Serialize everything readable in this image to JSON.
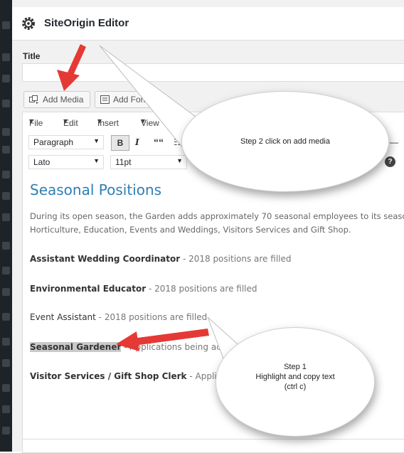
{
  "header": {
    "title": "SiteOrigin Editor"
  },
  "title_field": {
    "label": "Title",
    "value": ""
  },
  "media_buttons": {
    "add_media": "Add Media",
    "add_form": "Add Form"
  },
  "menubar": {
    "file": "File",
    "edit": "Edit",
    "insert": "Insert",
    "view": "View"
  },
  "toolbar": {
    "format": "Paragraph",
    "font": "Lato",
    "size": "11pt",
    "bold": "B",
    "italic": "I",
    "quote": "““",
    "dash": "—",
    "help": "?"
  },
  "content": {
    "heading": "Seasonal Positions",
    "intro_line1": "During its open season, the Garden adds approximately 70 seasonal employees to its seaso",
    "intro_line2": "Horticulture, Education, Events and Weddings, Visitors Services and Gift Shop.",
    "positions": [
      {
        "title": "Assistant Wedding Coordinator",
        "status": " - 2018 positions are filled"
      },
      {
        "title": "Environmental Educator",
        "status": " - 2018 positions are filled"
      },
      {
        "title": "Event Assistant",
        "status": " - 2018 positions are filled"
      },
      {
        "title": "Seasonal Gardener",
        "status": " - Applications being accep"
      },
      {
        "title": "Visitor Services / Gift Shop Clerk",
        "status": " - Applicat"
      }
    ]
  },
  "callouts": {
    "step2": "Step 2 click on add media",
    "step1_line1": "Step 1",
    "step1_line2": "Highlight and copy text",
    "step1_line3": "(ctrl c)"
  },
  "colors": {
    "heading": "#2f7fb5",
    "arrow": "#e53935",
    "highlight": "#c9c9c9",
    "admin_bar": "#1d2327"
  },
  "icons": {
    "header": "gear-icon",
    "add_media": "media-icon",
    "add_form": "form-icon",
    "help": "help-icon"
  }
}
